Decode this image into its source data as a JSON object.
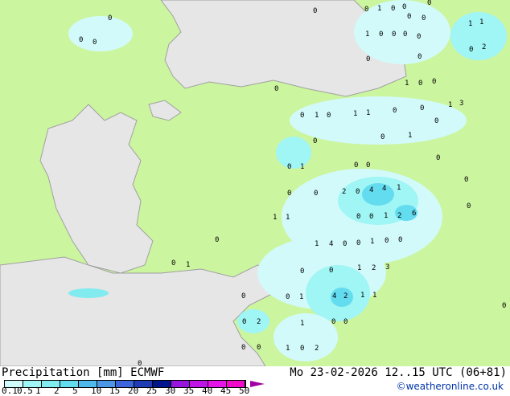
{
  "title": "Precipitation [mm]  ECMWF",
  "datetime": "Mo 23-02-2026 12..15 UTC (06+81)",
  "credit": "©weatheronline.co.uk",
  "colors": {
    "sea": "#e6e6e6",
    "land": "#ccf5a0",
    "border": "#a0a0a0"
  },
  "legend": {
    "ticks": [
      "0.1",
      "0.5",
      "1",
      "2",
      "5",
      "10",
      "15",
      "20",
      "25",
      "30",
      "35",
      "40",
      "45",
      "50"
    ],
    "colors": [
      "#d2fafa",
      "#a0f5f5",
      "#82ebf0",
      "#64dcf0",
      "#50b9eb",
      "#4b96e6",
      "#3c64dc",
      "#1e3cb4",
      "#00148c",
      "#9614dc",
      "#be14e6",
      "#e614e6",
      "#f00ac8",
      "#a000a0"
    ]
  },
  "map_labels": [
    "0",
    "0",
    "0",
    "0",
    "0",
    "1",
    "0",
    "0",
    "0",
    "0",
    "0",
    "1",
    "1",
    "1",
    "0",
    "0",
    "0",
    "0",
    "0",
    "2",
    "0",
    "0",
    "1",
    "0",
    "0",
    "0",
    "1",
    "3",
    "0",
    "1",
    "0",
    "1",
    "1",
    "0",
    "0",
    "0",
    "0",
    "0",
    "1",
    "0",
    "0",
    "1",
    "0",
    "0",
    "0",
    "0",
    "0",
    "2",
    "0",
    "4",
    "4",
    "1",
    "0",
    "1",
    "1",
    "0",
    "0",
    "1",
    "2",
    "6",
    "0",
    "1",
    "4",
    "0",
    "0",
    "1",
    "0",
    "0",
    "0",
    "1",
    "0",
    "0",
    "1",
    "2",
    "3",
    "4",
    "2",
    "1",
    "1",
    "0",
    "0",
    "1",
    "0",
    "0",
    "2",
    "1",
    "0",
    "0",
    "0",
    "0",
    "1",
    "0",
    "2",
    "0"
  ]
}
